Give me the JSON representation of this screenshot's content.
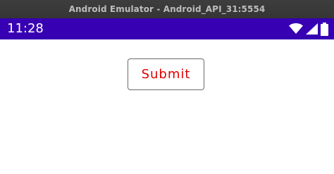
{
  "window": {
    "title": "Android Emulator - Android_API_31:5554"
  },
  "status_bar": {
    "time": "11:28",
    "background_color": "#3700b3",
    "icons": [
      "wifi-icon",
      "cellular-signal-icon",
      "battery-icon"
    ]
  },
  "main": {
    "submit_label": "Submit",
    "submit_text_color": "#e00000"
  }
}
